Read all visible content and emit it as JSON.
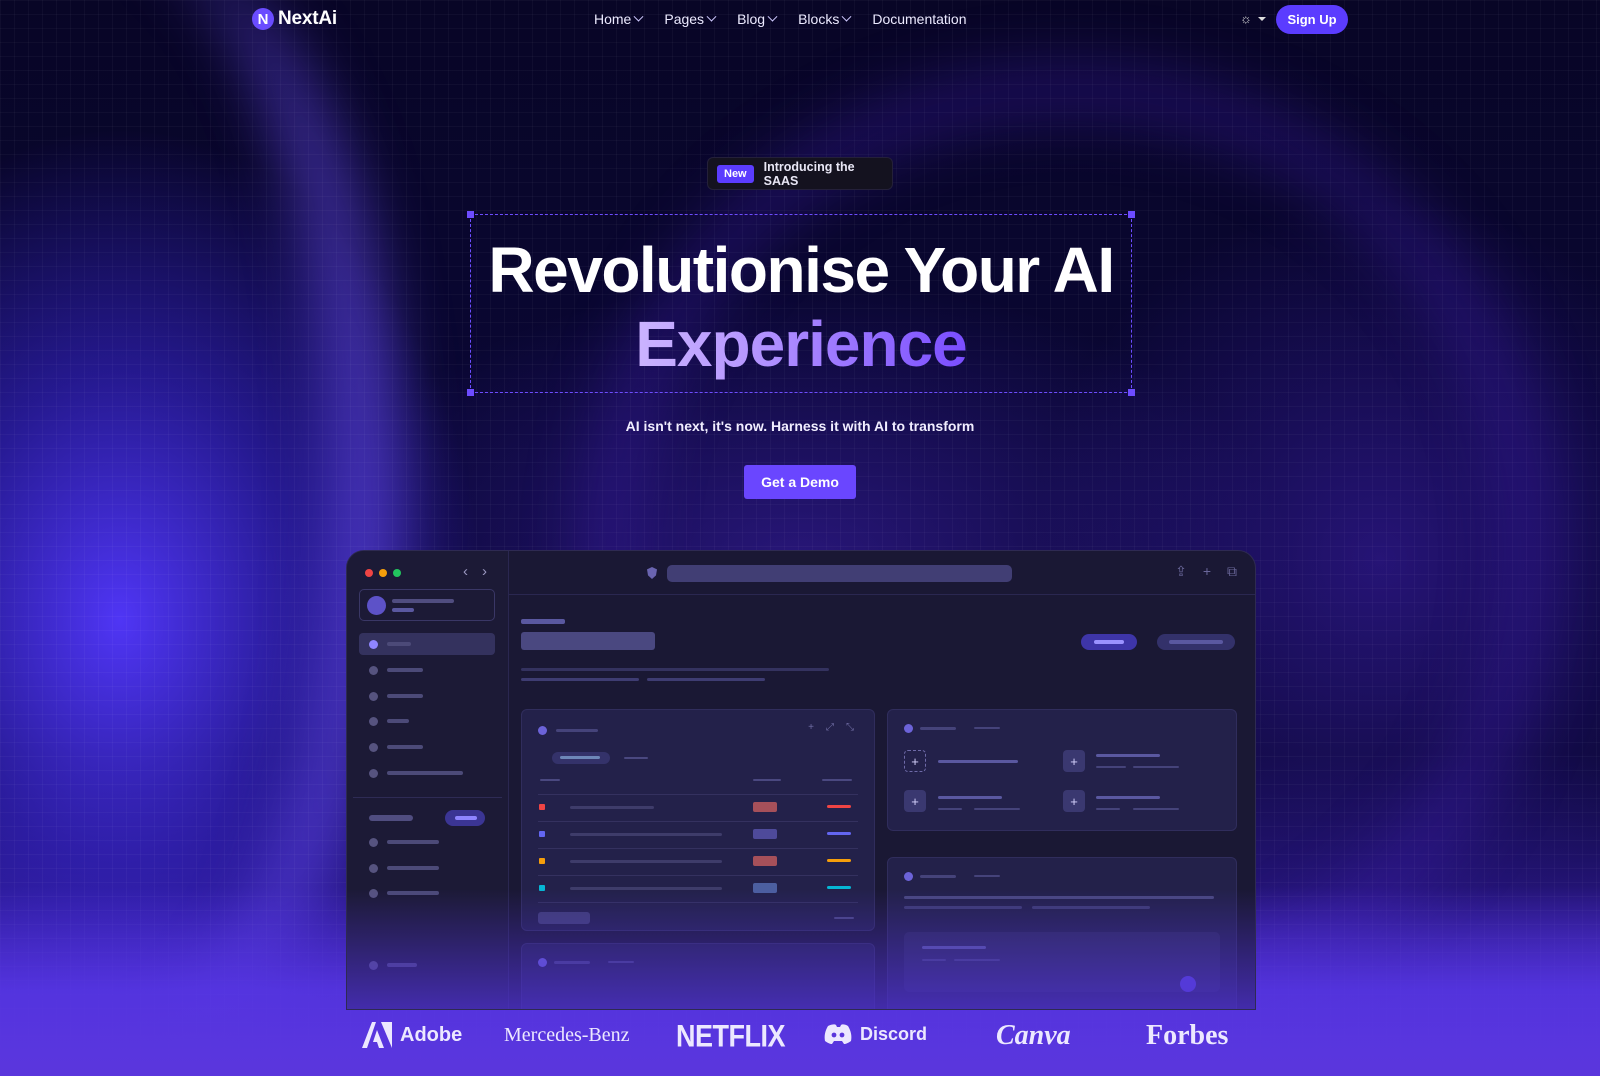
{
  "nav": {
    "logo_text": "NextAi",
    "logo_glyph": "N",
    "menu": [
      {
        "label": "Home",
        "has_dropdown": true
      },
      {
        "label": "Pages",
        "has_dropdown": true
      },
      {
        "label": "Blog",
        "has_dropdown": true
      },
      {
        "label": "Blocks",
        "has_dropdown": true
      },
      {
        "label": "Documentation",
        "has_dropdown": false
      }
    ],
    "theme_icon": "☼",
    "signup_label": "Sign Up"
  },
  "hero": {
    "badge_tag": "New",
    "badge_text": "Introducing the SAAS",
    "headline_line1": "Revolutionise Your AI",
    "headline_line2": "Experience",
    "subtitle": "AI isn't next, it's now. Harness it with AI to transform",
    "cta_label": "Get a Demo"
  },
  "app_preview": {
    "window_dots": [
      "#ef4444",
      "#f59e0b",
      "#22c55e"
    ],
    "back_arrow": "‹",
    "forward_arrow": "›",
    "toolbar_icons": [
      "⇪",
      "+",
      "⧉"
    ],
    "card_icons": [
      "+",
      "⤢",
      "⤡"
    ],
    "plus_symbol": "+",
    "row_colors": [
      "#ef4444",
      "#6366f1",
      "#f59e0b",
      "#06b6d4"
    ]
  },
  "logos": [
    {
      "name": "Adobe",
      "icon": "adobe-icon"
    },
    {
      "name": "Mercedes-Benz",
      "icon": ""
    },
    {
      "name": "NETFLIX",
      "icon": ""
    },
    {
      "name": "Discord",
      "icon": "discord-icon"
    },
    {
      "name": "Canva",
      "icon": ""
    },
    {
      "name": "Forbes",
      "icon": ""
    }
  ],
  "colors": {
    "accent": "#5b3cff",
    "background": "#080526"
  }
}
